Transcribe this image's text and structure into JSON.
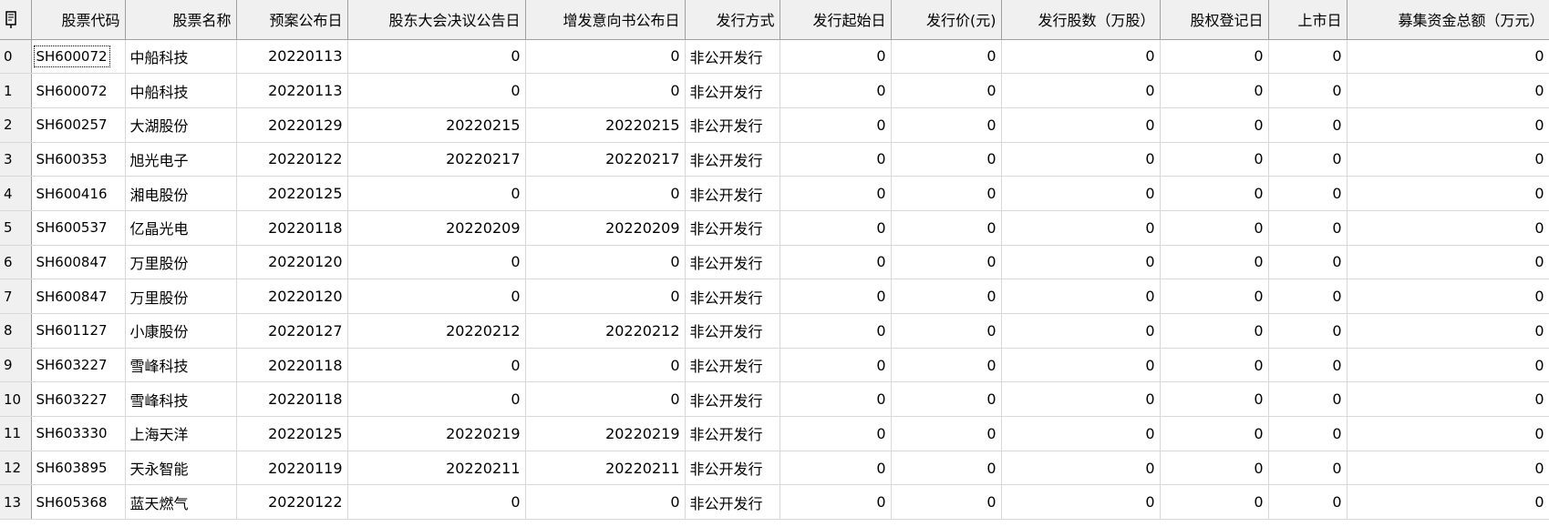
{
  "columns": [
    "",
    "股票代码",
    "股票名称",
    "预案公布日",
    "股东大会决议公告日",
    "增发意向书公布日",
    "发行方式",
    "发行起始日",
    "发行价(元)",
    "发行股数（万股）",
    "股权登记日",
    "上市日",
    "募集资金总额（万元）"
  ],
  "rows": [
    {
      "idx": "0",
      "code": "SH600072",
      "name": "中船科技",
      "plan": "20220113",
      "meeting": "0",
      "intent": "0",
      "method": "非公开发行",
      "start": "0",
      "price": "0",
      "shares": "0",
      "reg": "0",
      "list": "0",
      "total": "0"
    },
    {
      "idx": "1",
      "code": "SH600072",
      "name": "中船科技",
      "plan": "20220113",
      "meeting": "0",
      "intent": "0",
      "method": "非公开发行",
      "start": "0",
      "price": "0",
      "shares": "0",
      "reg": "0",
      "list": "0",
      "total": "0"
    },
    {
      "idx": "2",
      "code": "SH600257",
      "name": "大湖股份",
      "plan": "20220129",
      "meeting": "20220215",
      "intent": "20220215",
      "method": "非公开发行",
      "start": "0",
      "price": "0",
      "shares": "0",
      "reg": "0",
      "list": "0",
      "total": "0"
    },
    {
      "idx": "3",
      "code": "SH600353",
      "name": "旭光电子",
      "plan": "20220122",
      "meeting": "20220217",
      "intent": "20220217",
      "method": "非公开发行",
      "start": "0",
      "price": "0",
      "shares": "0",
      "reg": "0",
      "list": "0",
      "total": "0"
    },
    {
      "idx": "4",
      "code": "SH600416",
      "name": "湘电股份",
      "plan": "20220125",
      "meeting": "0",
      "intent": "0",
      "method": "非公开发行",
      "start": "0",
      "price": "0",
      "shares": "0",
      "reg": "0",
      "list": "0",
      "total": "0"
    },
    {
      "idx": "5",
      "code": "SH600537",
      "name": "亿晶光电",
      "plan": "20220118",
      "meeting": "20220209",
      "intent": "20220209",
      "method": "非公开发行",
      "start": "0",
      "price": "0",
      "shares": "0",
      "reg": "0",
      "list": "0",
      "total": "0"
    },
    {
      "idx": "6",
      "code": "SH600847",
      "name": "万里股份",
      "plan": "20220120",
      "meeting": "0",
      "intent": "0",
      "method": "非公开发行",
      "start": "0",
      "price": "0",
      "shares": "0",
      "reg": "0",
      "list": "0",
      "total": "0"
    },
    {
      "idx": "7",
      "code": "SH600847",
      "name": "万里股份",
      "plan": "20220120",
      "meeting": "0",
      "intent": "0",
      "method": "非公开发行",
      "start": "0",
      "price": "0",
      "shares": "0",
      "reg": "0",
      "list": "0",
      "total": "0"
    },
    {
      "idx": "8",
      "code": "SH601127",
      "name": "小康股份",
      "plan": "20220127",
      "meeting": "20220212",
      "intent": "20220212",
      "method": "非公开发行",
      "start": "0",
      "price": "0",
      "shares": "0",
      "reg": "0",
      "list": "0",
      "total": "0"
    },
    {
      "idx": "9",
      "code": "SH603227",
      "name": "雪峰科技",
      "plan": "20220118",
      "meeting": "0",
      "intent": "0",
      "method": "非公开发行",
      "start": "0",
      "price": "0",
      "shares": "0",
      "reg": "0",
      "list": "0",
      "total": "0"
    },
    {
      "idx": "10",
      "code": "SH603227",
      "name": "雪峰科技",
      "plan": "20220118",
      "meeting": "0",
      "intent": "0",
      "method": "非公开发行",
      "start": "0",
      "price": "0",
      "shares": "0",
      "reg": "0",
      "list": "0",
      "total": "0"
    },
    {
      "idx": "11",
      "code": "SH603330",
      "name": "上海天洋",
      "plan": "20220125",
      "meeting": "20220219",
      "intent": "20220219",
      "method": "非公开发行",
      "start": "0",
      "price": "0",
      "shares": "0",
      "reg": "0",
      "list": "0",
      "total": "0"
    },
    {
      "idx": "12",
      "code": "SH603895",
      "name": "天永智能",
      "plan": "20220119",
      "meeting": "20220211",
      "intent": "20220211",
      "method": "非公开发行",
      "start": "0",
      "price": "0",
      "shares": "0",
      "reg": "0",
      "list": "0",
      "total": "0"
    },
    {
      "idx": "13",
      "code": "SH605368",
      "name": "蓝天燃气",
      "plan": "20220122",
      "meeting": "0",
      "intent": "0",
      "method": "非公开发行",
      "start": "0",
      "price": "0",
      "shares": "0",
      "reg": "0",
      "list": "0",
      "total": "0"
    }
  ],
  "corner_icon": "pen-icon"
}
